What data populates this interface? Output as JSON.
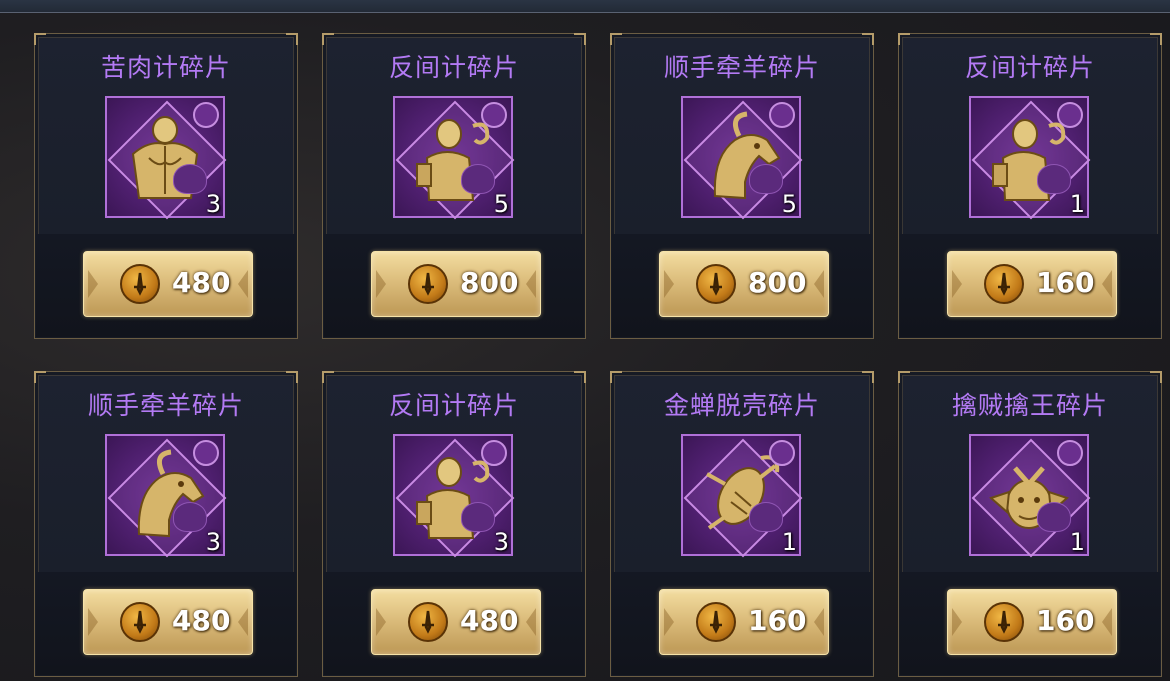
{
  "colors": {
    "title": "#b37af4",
    "frame": "#b070d8",
    "button": "#dcbd7c"
  },
  "icons": {
    "currency": "coin-sword-icon"
  },
  "items": [
    {
      "title": "苦肉计碎片",
      "art": "muscular-figure-icon",
      "count": "3",
      "price": "480"
    },
    {
      "title": "反间计碎片",
      "art": "scholar-figure-icon",
      "count": "5",
      "price": "800"
    },
    {
      "title": "顺手牵羊碎片",
      "art": "goat-head-icon",
      "count": "5",
      "price": "800"
    },
    {
      "title": "反间计碎片",
      "art": "scholar-figure-icon",
      "count": "1",
      "price": "160"
    },
    {
      "title": "顺手牵羊碎片",
      "art": "goat-head-icon",
      "count": "3",
      "price": "480"
    },
    {
      "title": "反间计碎片",
      "art": "scholar-figure-icon",
      "count": "3",
      "price": "480"
    },
    {
      "title": "金蝉脱壳碎片",
      "art": "cicada-icon",
      "count": "1",
      "price": "160"
    },
    {
      "title": "擒贼擒王碎片",
      "art": "warrior-mask-icon",
      "count": "1",
      "price": "160"
    }
  ]
}
